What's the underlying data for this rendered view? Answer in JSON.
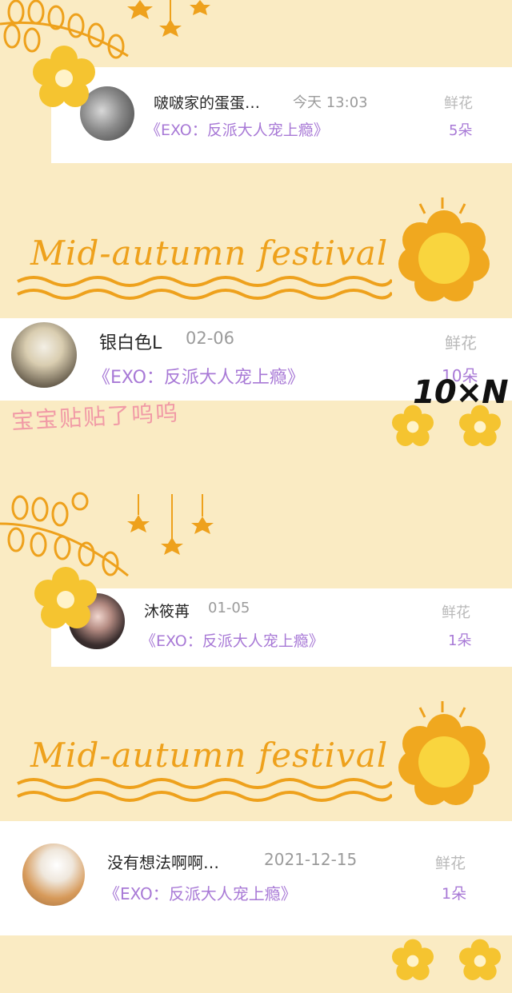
{
  "records": [
    {
      "name": "啵啵家的蛋蛋…",
      "time": "今天 13:03",
      "book": "《EXO：反派大人宠上瘾》",
      "flower_label": "鲜花",
      "flower_count": "5朵"
    },
    {
      "name": "银白色L",
      "time": "02-06",
      "book": "《EXO：反派大人宠上瘾》",
      "flower_label": "鲜花",
      "flower_count": "10朵"
    },
    {
      "name": "沐筱苒",
      "time": "01-05",
      "book": "《EXO：反派大人宠上瘾》",
      "flower_label": "鲜花",
      "flower_count": "1朵"
    },
    {
      "name": "没有想法啊啊…",
      "time": "2021-12-15",
      "book": "《EXO：反派大人宠上瘾》",
      "flower_label": "鲜花",
      "flower_count": "1朵"
    }
  ],
  "banners": [
    {
      "text": "Mid-autumn festival"
    },
    {
      "text": "Mid-autumn festival"
    }
  ],
  "stickers": {
    "brand": "10×N",
    "handwriting": "宝宝贴贴了呜呜"
  },
  "colors": {
    "background": "#faebc3",
    "accent": "#a879d6",
    "deco_orange": "#eea11c",
    "deco_yellow": "#f5c430"
  }
}
